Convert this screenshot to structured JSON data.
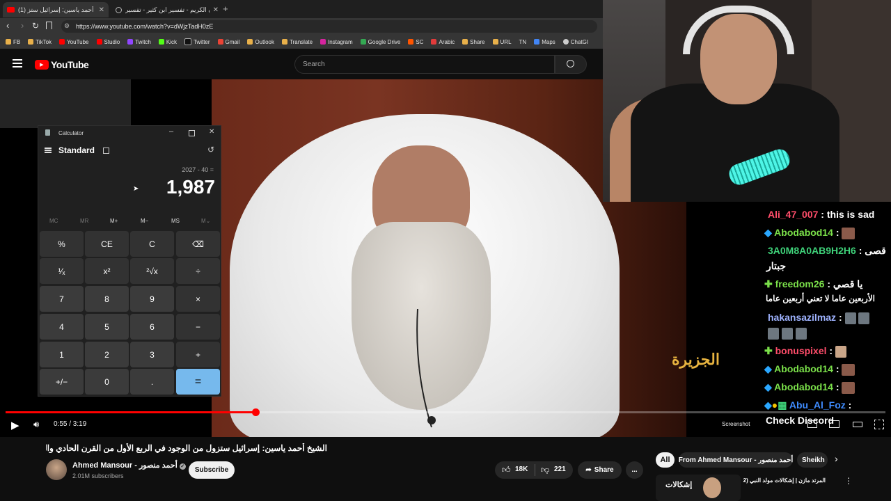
{
  "browser": {
    "tabs": [
      {
        "title": "(1) الشيخ أحمد ياسين: إسرائيل ستز..."
      },
      {
        "title": "القرآن الكريم - تفسير ابن كثير - تفسير ..."
      }
    ],
    "new_tab_label": "+",
    "url": "https://www.youtube.com/watch?v=dWjzTadH0zE",
    "bookmarks": [
      "FB",
      "TikTok",
      "YouTube",
      "Studio",
      "Twitch",
      "Kick",
      "Twitter",
      "Gmail",
      "Outlook",
      "Translate",
      "Instagram",
      "Google Drive",
      "SC",
      "Arabic",
      "Share",
      "URL",
      "TN",
      "Maps",
      "ChatGI"
    ]
  },
  "youtube": {
    "logo_text": "YouTube",
    "search_placeholder": "Search",
    "video_title": "الشيخ أحمد ياسين: إسرائيل ستزول من الوجود في الربع الأول من القرن الحادي والعشرين",
    "channel_name": "Ahmed Mansour - أحمد منصور",
    "subscribers": "2.01M subscribers",
    "subscribe_label": "Subscribe",
    "likes": "18K",
    "dislikes": "221",
    "share_label": "Share",
    "more_label": "...",
    "chips": [
      "All",
      "From Ahmed Mansour - أحمد منصور",
      "Sheikh"
    ],
    "suggest_title": "المرتد مازن | إشكالات مولد النبي (2)",
    "suggest_thumb_text": "إشكالات",
    "player": {
      "time": "0:55 / 3:19",
      "progress_fraction": 0.284,
      "screenshot_label": "Screenshot"
    }
  },
  "calculator": {
    "window_title": "Calculator",
    "mode": "Standard",
    "expression": "2027 - 40 =",
    "result": "1,987",
    "memory_buttons": [
      "MC",
      "MR",
      "M+",
      "M−",
      "MS",
      "M⌄"
    ],
    "keys": [
      [
        "%",
        "CE",
        "C",
        "⌫"
      ],
      [
        "¹⁄ₓ",
        "x²",
        "²√x",
        "÷"
      ],
      [
        "7",
        "8",
        "9",
        "×"
      ],
      [
        "4",
        "5",
        "6",
        "−"
      ],
      [
        "1",
        "2",
        "3",
        "+"
      ],
      [
        "+/−",
        "0",
        ".",
        "="
      ]
    ]
  },
  "watermark": "الجزيرة",
  "chat": {
    "lines": [
      {
        "user": "Ali_47_007",
        "text": "this is sad",
        "color": "#ff4d6a"
      },
      {
        "user": "Abodabod14",
        "text": "",
        "color": "#7be04a"
      },
      {
        "user": "3A0M8A0AB9H2H6",
        "text": "قصى",
        "color": "#3fd37a"
      },
      {
        "user": "",
        "text": "جبتار",
        "color": "#ffffff"
      },
      {
        "user": "freedom26",
        "text": "يا قصي",
        "color": "#7be04a"
      },
      {
        "user": "",
        "text": "الأربعين عاما لا تعني أربعين عاما",
        "color": "#ffffff"
      },
      {
        "user": "hakansazilmaz",
        "text": "",
        "color": "#9fb3ff"
      },
      {
        "user": "bonuspixel",
        "text": "",
        "color": "#ff4d6a"
      },
      {
        "user": "Abodabod14",
        "text": "",
        "color": "#7be04a"
      },
      {
        "user": "Abodabod14",
        "text": "",
        "color": "#7be04a"
      },
      {
        "user": "Abu_Al_Foz",
        "text": "",
        "color": "#3f8cff"
      },
      {
        "user": "",
        "text": "Check Discord",
        "color": "#ffffff"
      }
    ]
  }
}
